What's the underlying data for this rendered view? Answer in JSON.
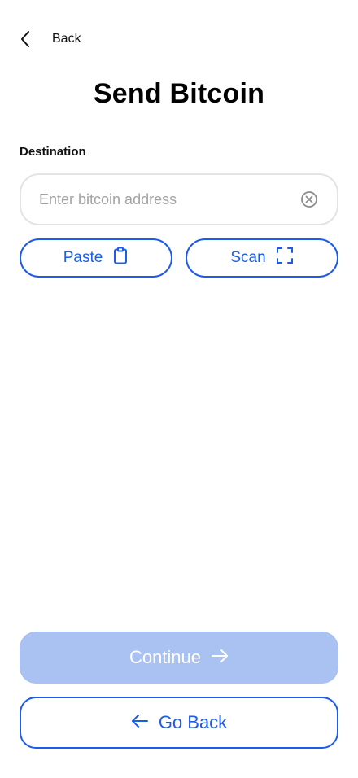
{
  "header": {
    "back_label": "Back"
  },
  "page": {
    "title": "Send Bitcoin"
  },
  "destination": {
    "label": "Destination",
    "placeholder": "Enter bitcoin address",
    "value": ""
  },
  "actions": {
    "paste_label": "Paste",
    "scan_label": "Scan"
  },
  "footer": {
    "continue_label": "Continue",
    "go_back_label": "Go Back"
  },
  "colors": {
    "accent": "#1d5ce8",
    "disabled_button": "#a9c2f2",
    "input_border": "#e3e3e3",
    "placeholder": "#a3a3a3"
  },
  "icons": {
    "back": "chevron-left-icon",
    "clear": "clear-circle-icon",
    "paste": "clipboard-icon",
    "scan": "scan-frame-icon",
    "continue": "arrow-right-icon",
    "go_back": "arrow-left-icon"
  }
}
